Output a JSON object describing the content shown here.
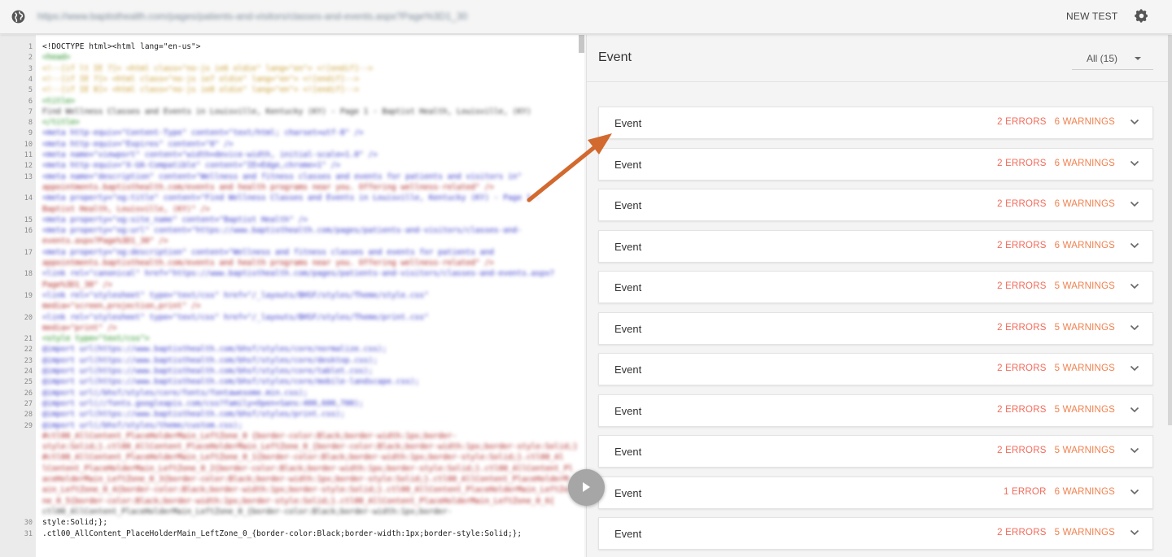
{
  "topbar": {
    "url": "https://www.baptisthealth.com/pages/patients-and-visitors/classes-and-events.aspx?Page%3D1_30",
    "new_test_label": "NEW TEST",
    "globe_icon": "globe-icon",
    "settings_icon": "gear-icon"
  },
  "editor": {
    "lines": [
      {
        "n": "1",
        "text": "<!DOCTYPE html><html lang=\"en-us\">",
        "blur": false
      },
      {
        "n": "2",
        "text": "    <head>",
        "blur": true
      },
      {
        "n": "3",
        "text": "        <!--[if lt IE 7]> <html class=\"no-js ie6 oldie\" lang=\"en\"> <![endif]-->",
        "blur": true
      },
      {
        "n": "4",
        "text": "        <!--[if IE 7]>    <html class=\"no-js ie7 oldie\" lang=\"en\"> <![endif]-->",
        "blur": true
      },
      {
        "n": "5",
        "text": "        <!--[if IE 8]>    <html class=\"no-js ie8 oldie\" lang=\"en\"> <![endif]-->",
        "blur": true
      },
      {
        "n": "6",
        "text": "    <title>",
        "blur": true
      },
      {
        "n": "7",
        "text": "        Find Wellness Classes and Events in Louisville, Kentucky (KY) - Page 1 - Baptist Health, Louisville, (KY)",
        "blur": true
      },
      {
        "n": "8",
        "text": "    </title>",
        "blur": true
      },
      {
        "n": "9",
        "text": "        <meta http-equiv=\"Content-Type\" content=\"text/html; charset=utf-8\" />",
        "blur": true
      },
      {
        "n": "10",
        "text": "        <meta http-equiv=\"Expires\" content=\"0\" />",
        "blur": true
      },
      {
        "n": "11",
        "text": "        <meta name=\"viewport\" content=\"width=device-width, initial-scale=1.0\" />",
        "blur": true
      },
      {
        "n": "12",
        "text": "        <meta http-equiv=\"X-UA-Compatible\" content=\"IE=Edge,chrome=1\" />",
        "blur": true
      },
      {
        "n": "13",
        "text": "        <meta name=\"description\" content=\"Wellness and fitness classes and events for patients and visitors in\"",
        "blur": true
      },
      {
        "n": "",
        "text": "appointments.baptisthealth.com/events and health programs near you. Offering wellness-related\" />",
        "blur": true
      },
      {
        "n": "14",
        "text": "    <meta property=\"og:title\" content=\"Find Wellness Classes and Events in Louisville, Kentucky (KY) - Page 1 -",
        "blur": true
      },
      {
        "n": "",
        "text": "Baptist Health, Louisville, (KY)\" />",
        "blur": true
      },
      {
        "n": "15",
        "text": "    <meta property=\"og:site_name\" content=\"Baptist Health\" />",
        "blur": true
      },
      {
        "n": "16",
        "text": "    <meta property=\"og:url\" content=\"https://www.baptisthealth.com/pages/patients-and-visitors/classes-and-",
        "blur": true
      },
      {
        "n": "",
        "text": "events.aspx?Page%3D1_30\" />",
        "blur": true
      },
      {
        "n": "17",
        "text": "    <meta property=\"og:description\" content=\"Wellness and fitness classes and events for patients and",
        "blur": true
      },
      {
        "n": "",
        "text": "appointments.baptisthealth.com/events and health programs near you. Offering wellness-related\" />",
        "blur": true
      },
      {
        "n": "18",
        "text": "    <link rel=\"canonical\" href=\"https://www.baptisthealth.com/pages/patients-and-visitors/classes-and-events.aspx?",
        "blur": true
      },
      {
        "n": "",
        "text": "Page%3D1_30\" />",
        "blur": true
      },
      {
        "n": "19",
        "text": "        <link rel=\"stylesheet\" type=\"text/css\" href=\"/_layouts/BHSF/styles/Theme/style.css\"",
        "blur": true
      },
      {
        "n": "",
        "text": "media=\"screen,projection,print\" />",
        "blur": true
      },
      {
        "n": "20",
        "text": "        <link rel=\"stylesheet\" type=\"text/css\" href=\"/_layouts/BHSF/styles/Theme/print.css\"",
        "blur": true
      },
      {
        "n": "",
        "text": "media=\"print\" />",
        "blur": true
      },
      {
        "n": "21",
        "text": "        <style type=\"text/css\">",
        "blur": true
      },
      {
        "n": "22",
        "text": "            @import url(https://www.baptisthealth.com/bhsf/styles/core/normalize.css);",
        "blur": true
      },
      {
        "n": "23",
        "text": "            @import url(https://www.baptisthealth.com/bhsf/styles/core/desktop.css);",
        "blur": true
      },
      {
        "n": "24",
        "text": "            @import url(https://www.baptisthealth.com/bhsf/styles/core/tablet.css);",
        "blur": true
      },
      {
        "n": "25",
        "text": "            @import url(https://www.baptisthealth.com/bhsf/styles/core/mobile-landscape.css);",
        "blur": true
      },
      {
        "n": "26",
        "text": "            @import url(/bhsf/styles/core/fonts/fontawesome.min.css);",
        "blur": true
      },
      {
        "n": "27",
        "text": "            @import url(//fonts.googleapis.com/css?family=Open+Sans:400,600,700);",
        "blur": true
      },
      {
        "n": "28",
        "text": "            @import url(https://www.baptisthealth.com/bhsf/styles/print.css);",
        "blur": true
      },
      {
        "n": "29",
        "text": "            @import url(/bhsf/styles/theme/custom.css);",
        "blur": true
      },
      {
        "n": "",
        "text": "#ctl00_AllContent_PlaceHolderMain_LeftZone_0 {border-color:Black;border-width:1px;border-",
        "blur": true
      },
      {
        "n": "",
        "text": "style:Solid;}.ctl00_AllContent_PlaceHolderMain_LeftZone_0_{border-color:Black;border-width:1px;border-style:Solid;}",
        "blur": true
      },
      {
        "n": "",
        "text": "#ctl00_AllContent_PlaceHolderMain_LeftZone_0_1{border-color:Black;border-width:1px;border-style:Solid;}.ctl00_Al",
        "blur": true
      },
      {
        "n": "",
        "text": "lContent_PlaceHolderMain_LeftZone_0_2{border-color:Black;border-width:1px;border-style:Solid;}.ctl00_AllContent_Pl",
        "blur": true
      },
      {
        "n": "",
        "text": "aceHolderMain_LeftZone_0_3{border-color:Black;border-width:1px;border-style:Solid;}.ctl00_AllContent_PlaceHolderM",
        "blur": true
      },
      {
        "n": "",
        "text": "ain_LeftZone_0_4{border-color:Black;border-width:1px;border-style:Solid;}.ctl00_AllContent_PlaceHolderMain_LeftZo",
        "blur": true
      },
      {
        "n": "",
        "text": "ne_0_5{border-color:Black;border-width:1px;border-style:Solid;}.ctl00_AllContent_PlaceHolderMain_LeftZone_0_6{",
        "blur": true
      },
      {
        "n": "",
        "text": "        ctl00_AllContent_PlaceHolderMain_LeftZone_0_{border-color:Black;border-width:1px;border-",
        "blur": true
      },
      {
        "n": "30",
        "text": "style:Solid;};",
        "blur": false
      },
      {
        "n": "31",
        "text": "        .ctl00_AllContent_PlaceHolderMain_LeftZone_0_{border-color:Black;border-width:1px;border-style:Solid;};",
        "blur": false
      }
    ],
    "run_icon": "play-icon"
  },
  "panel": {
    "title": "Event",
    "filter_label": "All (15)",
    "expand_icon": "chevron-down-icon",
    "events": [
      {
        "title": "Event",
        "errors": "2 ERRORS",
        "warnings": "6 WARNINGS"
      },
      {
        "title": "Event",
        "errors": "2 ERRORS",
        "warnings": "6 WARNINGS"
      },
      {
        "title": "Event",
        "errors": "2 ERRORS",
        "warnings": "6 WARNINGS"
      },
      {
        "title": "Event",
        "errors": "2 ERRORS",
        "warnings": "6 WARNINGS"
      },
      {
        "title": "Event",
        "errors": "2 ERRORS",
        "warnings": "5 WARNINGS"
      },
      {
        "title": "Event",
        "errors": "2 ERRORS",
        "warnings": "5 WARNINGS"
      },
      {
        "title": "Event",
        "errors": "2 ERRORS",
        "warnings": "5 WARNINGS"
      },
      {
        "title": "Event",
        "errors": "2 ERRORS",
        "warnings": "5 WARNINGS"
      },
      {
        "title": "Event",
        "errors": "2 ERRORS",
        "warnings": "5 WARNINGS"
      },
      {
        "title": "Event",
        "errors": "1 ERROR",
        "warnings": "6 WARNINGS"
      },
      {
        "title": "Event",
        "errors": "2 ERRORS",
        "warnings": "5 WARNINGS"
      }
    ]
  },
  "colors": {
    "error": "#f26b5b",
    "warning": "#f0814f",
    "annotation_arrow": "#d2692e"
  }
}
